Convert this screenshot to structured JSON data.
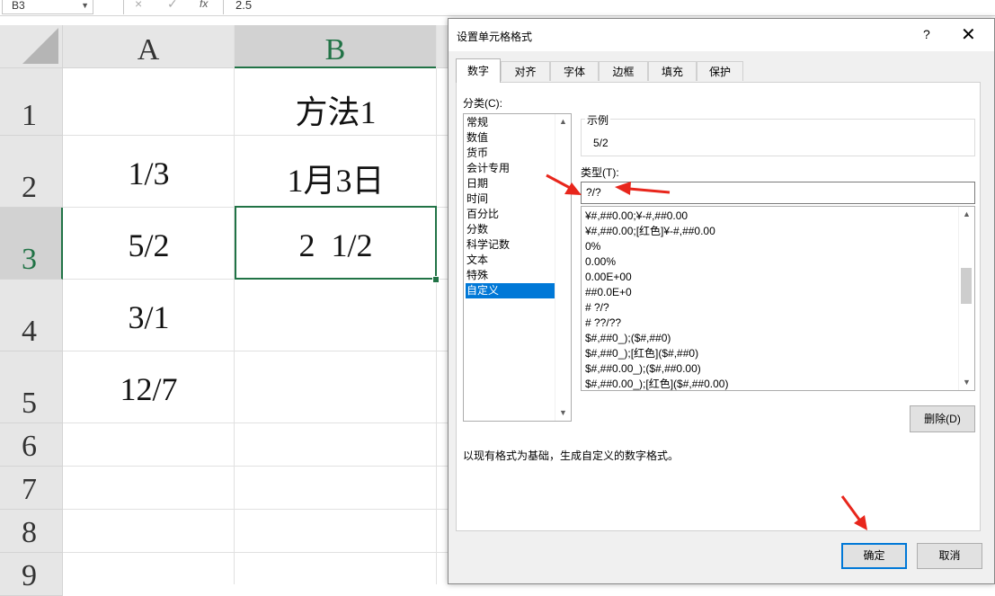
{
  "formula_bar": {
    "name_box": "B3",
    "cancel_icon": "×",
    "enter_icon": "✓",
    "fx_label": "fx",
    "value": "2.5"
  },
  "sheet": {
    "columns": [
      "A",
      "B"
    ],
    "rows": [
      "1",
      "2",
      "3",
      "4",
      "5",
      "6",
      "7",
      "8",
      "9"
    ],
    "cells": {
      "B1": "方法1",
      "A2": "1/3",
      "B2": "1月3日",
      "A3": "5/2",
      "B3": "2  1/2",
      "A4": "3/1",
      "A5": "12/7"
    },
    "selected_cell": "B3"
  },
  "dialog": {
    "title": "设置单元格格式",
    "help": "?",
    "close": "✕",
    "tabs": [
      "数字",
      "对齐",
      "字体",
      "边框",
      "填充",
      "保护"
    ],
    "active_tab": "数字",
    "category_label": "分类(C):",
    "categories": [
      "常规",
      "数值",
      "货币",
      "会计专用",
      "日期",
      "时间",
      "百分比",
      "分数",
      "科学记数",
      "文本",
      "特殊",
      "自定义"
    ],
    "selected_category": "自定义",
    "sample_label": "示例",
    "sample_value": "5/2",
    "type_label": "类型(T):",
    "type_value": "?/?",
    "formats": [
      "¥#,##0.00;¥-#,##0.00",
      "¥#,##0.00;[红色]¥-#,##0.00",
      "0%",
      "0.00%",
      "0.00E+00",
      "##0.0E+0",
      "# ?/?",
      "# ??/??",
      "$#,##0_);($#,##0)",
      "$#,##0_);[红色]($#,##0)",
      "$#,##0.00_);($#,##0.00)",
      "$#,##0.00_);[红色]($#,##0.00)"
    ],
    "delete_button": "删除(D)",
    "description": "以现有格式为基础，生成自定义的数字格式。",
    "ok_button": "确定",
    "cancel_button": "取消"
  },
  "colors": {
    "excel_green": "#217346",
    "selection_blue": "#0078d7",
    "annotation_red": "#e8261c"
  }
}
